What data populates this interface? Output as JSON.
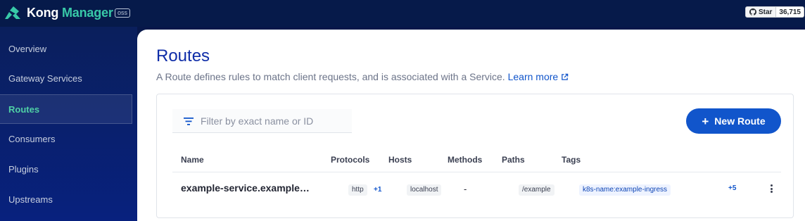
{
  "brand": {
    "word1": "Kong",
    "word2": "Manager",
    "badge": "oss",
    "logo_icon": "kong-logo-icon"
  },
  "github": {
    "star_label": "Star",
    "star_count": "36,715",
    "icon": "github-icon"
  },
  "sidebar": {
    "items": [
      {
        "label": "Overview",
        "active": false
      },
      {
        "label": "Gateway Services",
        "active": false
      },
      {
        "label": "Routes",
        "active": true
      },
      {
        "label": "Consumers",
        "active": false
      },
      {
        "label": "Plugins",
        "active": false
      },
      {
        "label": "Upstreams",
        "active": false
      }
    ]
  },
  "page": {
    "title": "Routes",
    "description": "A Route defines rules to match client requests, and is associated with a Service.",
    "learn_more": "Learn more"
  },
  "toolbar": {
    "filter_placeholder": "Filter by exact name or ID",
    "filter_value": "",
    "new_button_plus": "+",
    "new_button": "New Route"
  },
  "table": {
    "columns": [
      "Name",
      "Protocols",
      "Hosts",
      "Methods",
      "Paths",
      "Tags"
    ],
    "rows": [
      {
        "name": "example-service.example…",
        "protocol": "http",
        "protocol_more": "+1",
        "host": "localhost",
        "methods": "-",
        "path": "/example",
        "tag": "k8s-name:example-ingress",
        "tag_more": "+5"
      }
    ]
  },
  "colors": {
    "accent": "#1155cb",
    "brand_green": "#38c9a8",
    "nav_bg": "#061a4a",
    "active_nav": "#4fd1a5"
  }
}
